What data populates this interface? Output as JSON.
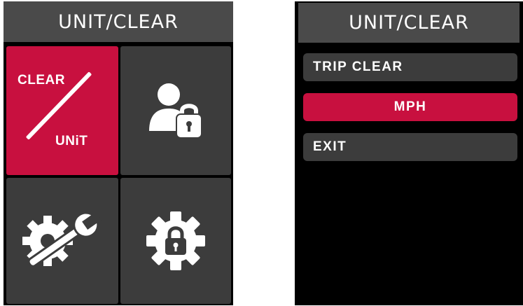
{
  "left_screen": {
    "title": "UNIT/CLEAR",
    "tiles": [
      {
        "top_text": "CLEAR",
        "bottom_text": "UNiT",
        "selected": true
      },
      {
        "icon": "user-lock-icon"
      },
      {
        "icon": "wrench-gear-icon"
      },
      {
        "icon": "gear-lock-icon"
      }
    ]
  },
  "right_screen": {
    "title": "UNIT/CLEAR",
    "menu": [
      {
        "label": "TRIP CLEAR"
      },
      {
        "label": "MPH",
        "selected": true
      },
      {
        "label": "EXIT"
      }
    ]
  },
  "colors": {
    "accent": "#c8103f",
    "tile": "#3c3c3c",
    "titlebar": "#4a4a4a",
    "background": "#000000",
    "text": "#ffffff"
  }
}
